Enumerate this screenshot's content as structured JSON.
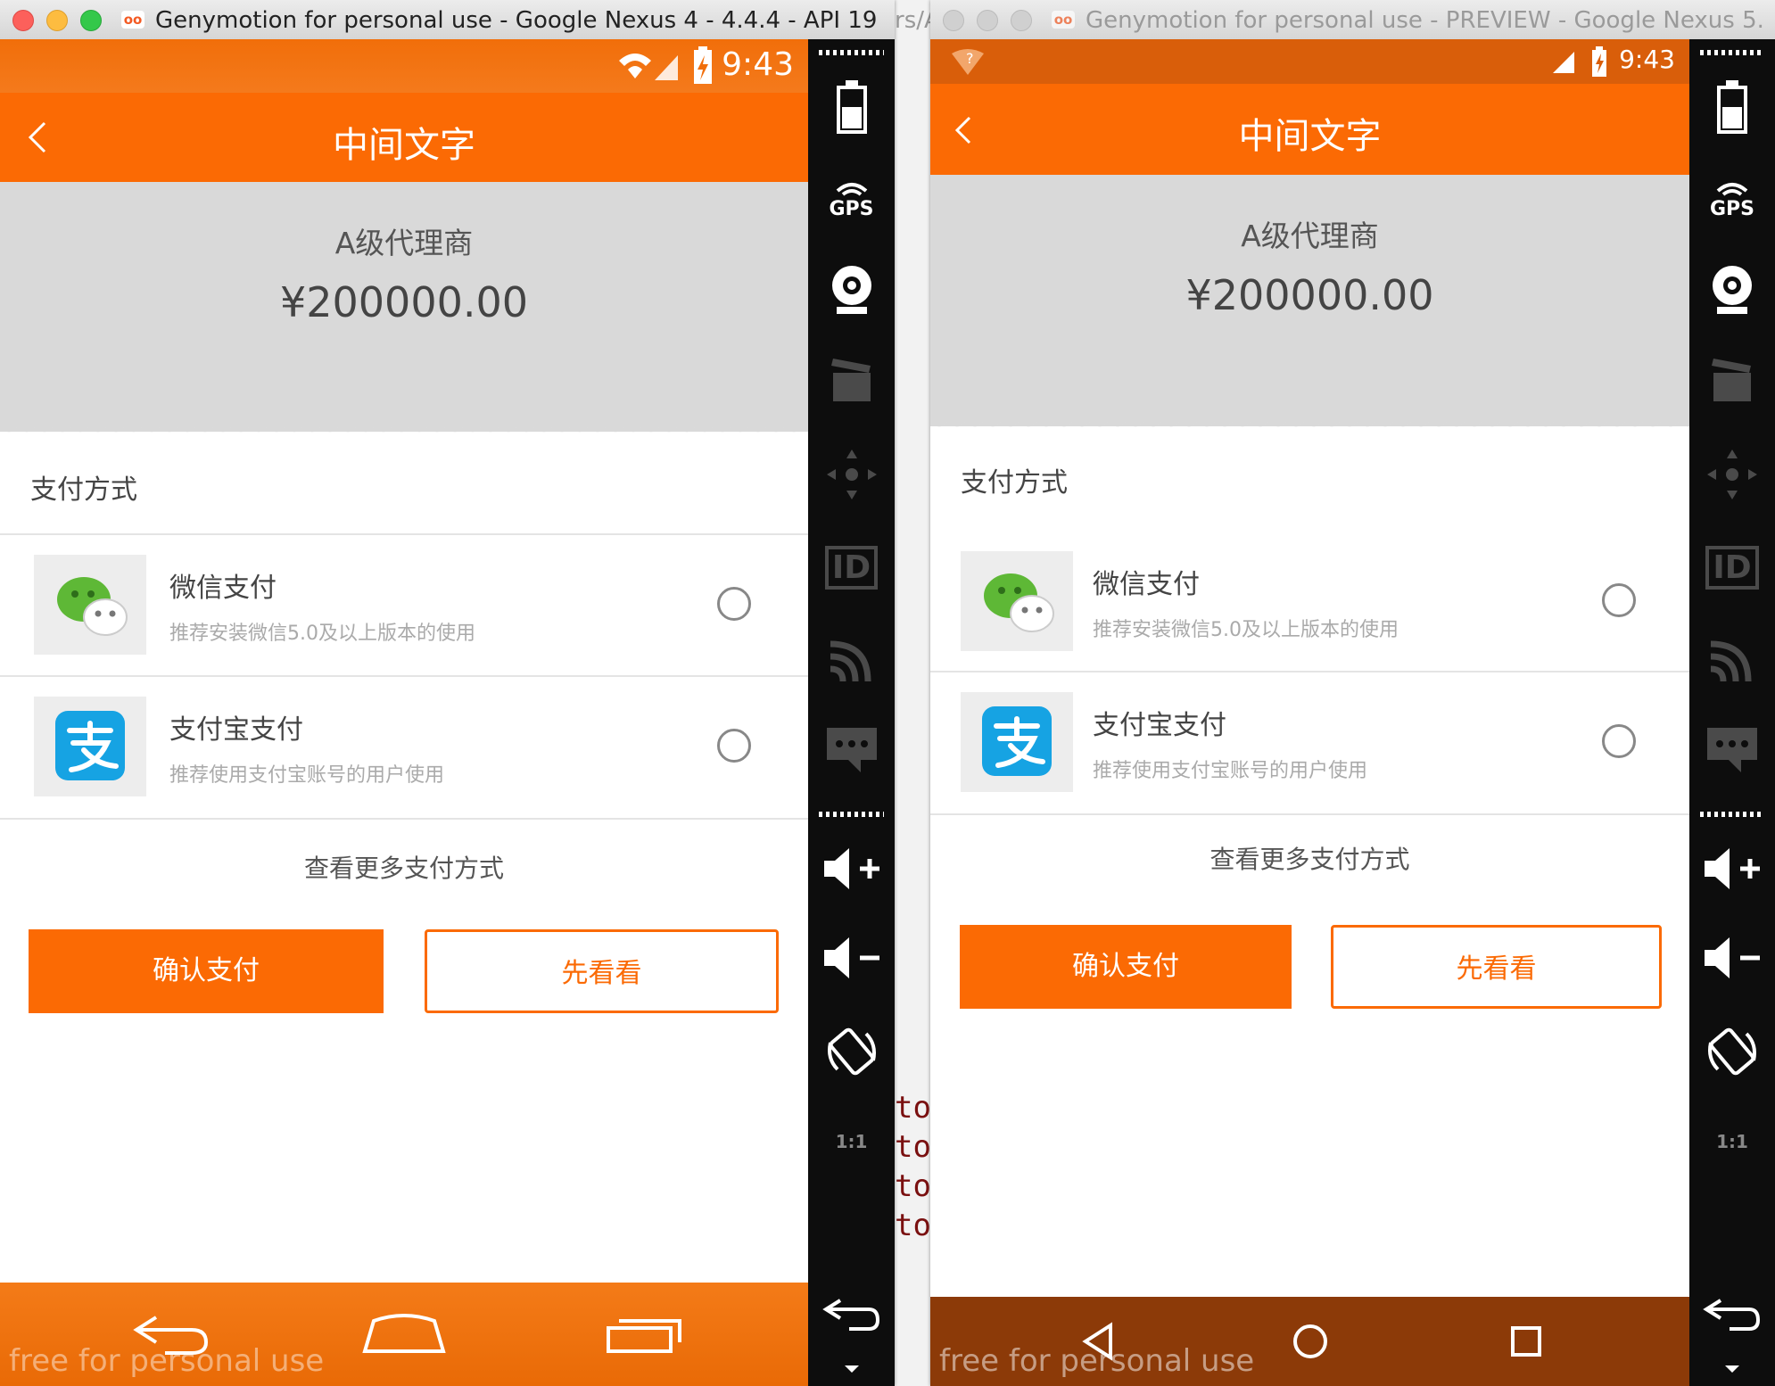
{
  "background_window": {
    "fragment_top": "rs/A",
    "code_lines": [
      "tol",
      "tol",
      "tol",
      "tol"
    ]
  },
  "window1": {
    "title": "Genymotion for personal use - Google Nexus 4 - 4.4.4 - API 19...",
    "logo_text": "oo",
    "status": {
      "time": "9:43"
    },
    "app": {
      "title": "中间文字",
      "back_icon": "chevron-left-icon",
      "agent_level": "A级代理商",
      "amount": "¥200000.00",
      "section_title": "支付方式",
      "methods": [
        {
          "name": "微信支付",
          "desc": "推荐安装微信5.0及以上版本的使用",
          "icon": "wechat-icon"
        },
        {
          "name": "支付宝支付",
          "desc": "推荐使用支付宝账号的用户使用",
          "icon": "alipay-icon"
        }
      ],
      "more_label": "查看更多支付方式",
      "confirm_label": "确认支付",
      "preview_label": "先看看"
    },
    "watermark": "free for personal use",
    "sidebar_labels": {
      "gps": "GPS",
      "id": "ID",
      "ratio": "1:1"
    }
  },
  "window2": {
    "title": "Genymotion for personal use - PREVIEW - Google Nexus 5...",
    "logo_text": "oo",
    "status": {
      "time": "9:43",
      "wifi_badge": "?"
    },
    "app": {
      "title": "中间文字",
      "agent_level": "A级代理商",
      "amount": "¥200000.00",
      "section_title": "支付方式",
      "methods": [
        {
          "name": "微信支付",
          "desc": "推荐安装微信5.0及以上版本的使用",
          "icon": "wechat-icon"
        },
        {
          "name": "支付宝支付",
          "desc": "推荐使用支付宝账号的用户使用",
          "icon": "alipay-icon"
        }
      ],
      "more_label": "查看更多支付方式",
      "confirm_label": "确认支付",
      "preview_label": "先看看"
    },
    "watermark": "free for personal use",
    "sidebar_labels": {
      "gps": "GPS",
      "id": "ID",
      "ratio": "1:1"
    }
  },
  "colors": {
    "accent": "#fb6a04",
    "sidebar": "#0d0d0d",
    "header_gray": "#d9d9d9",
    "wechat": "#5eb836",
    "alipay": "#16a3e3"
  }
}
